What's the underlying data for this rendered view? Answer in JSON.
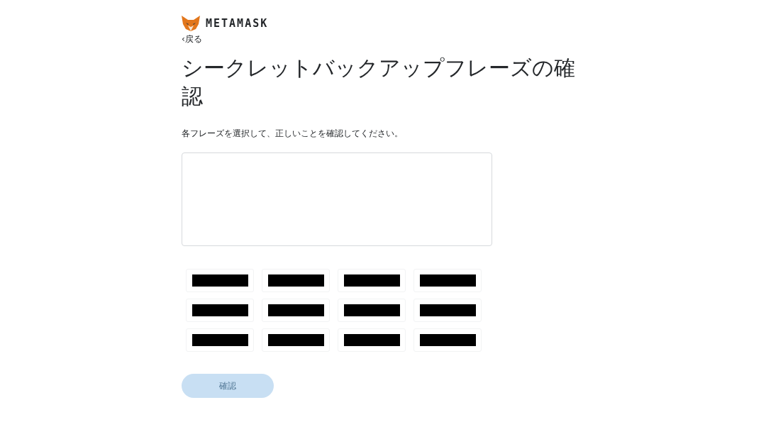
{
  "logo": {
    "text": "METAMASK"
  },
  "back_link": {
    "icon": "‹",
    "label": "戻る"
  },
  "title": "シークレットバックアップフレーズの確認",
  "instruction": "各フレーズを選択して、正しいことを確認してください。",
  "word_chips": [
    {
      "kind": "redacted"
    },
    {
      "kind": "redacted"
    },
    {
      "kind": "redacted"
    },
    {
      "kind": "redacted"
    },
    {
      "kind": "redacted"
    },
    {
      "kind": "redacted"
    },
    {
      "kind": "redacted"
    },
    {
      "kind": "redacted"
    },
    {
      "kind": "redacted"
    },
    {
      "kind": "redacted"
    },
    {
      "kind": "redacted"
    },
    {
      "kind": "redacted"
    }
  ],
  "confirm_button": {
    "label": "確認",
    "disabled": true
  }
}
